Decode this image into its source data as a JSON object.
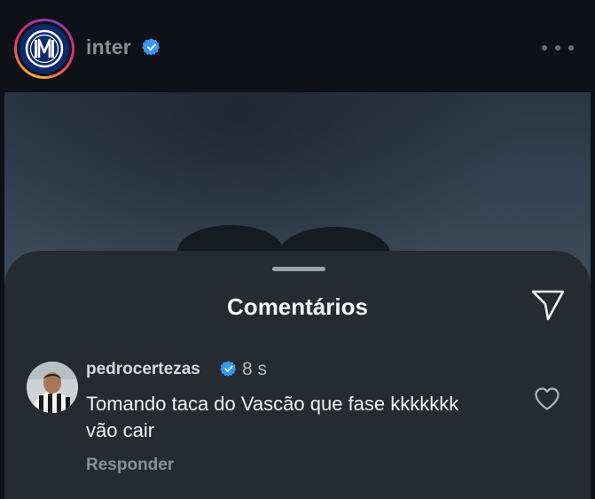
{
  "post_header": {
    "username": "inter",
    "verified": true,
    "more_icon": "more-horizontal-icon"
  },
  "comments_sheet": {
    "title": "Comentários",
    "send_icon": "send-paper-plane-icon",
    "comments": [
      {
        "username": "pedrocertezas",
        "verified": true,
        "time": "8 s",
        "text": "Tomando taca do Vascão que fase kkkkkkk vão cair",
        "reply_label": "Responder",
        "like_icon": "heart-outline-icon"
      }
    ]
  },
  "colors": {
    "background": "#0e1117",
    "sheet": "#262b31",
    "verified_blue": "#3897f0",
    "text_primary": "#f2f2f2",
    "text_secondary": "#8d9196"
  }
}
